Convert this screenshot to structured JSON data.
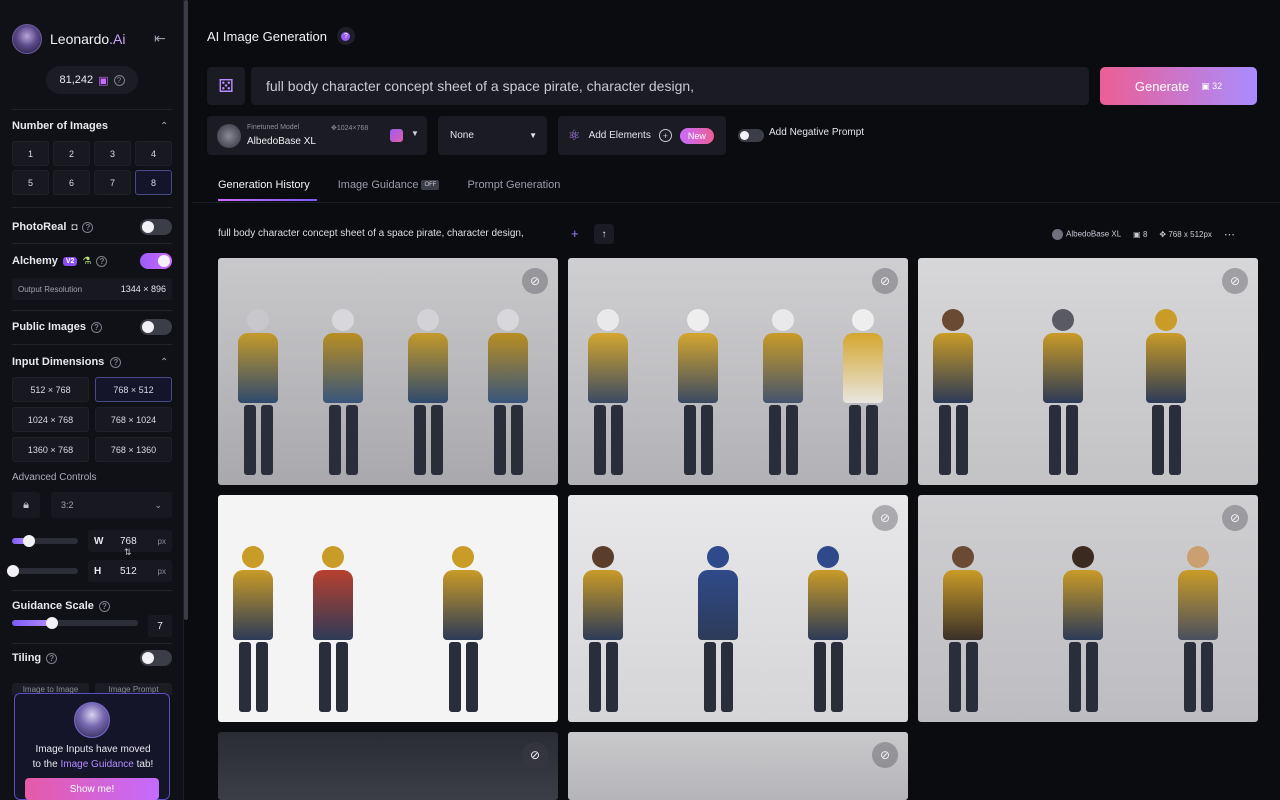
{
  "sidebar": {
    "brand": "Leonardo",
    "brand_ai": ".Ai",
    "credits": "81,242",
    "number_of_images": {
      "title": "Number of Images",
      "options": [
        "1",
        "2",
        "3",
        "4",
        "5",
        "6",
        "7",
        "8"
      ],
      "selected": "8"
    },
    "photoreal": {
      "label": "PhotoReal",
      "on": false
    },
    "alchemy": {
      "label": "Alchemy",
      "badge": "V2",
      "on": true
    },
    "output_resolution": {
      "label": "Output Resolution",
      "value": "1344 × 896"
    },
    "public_images": {
      "label": "Public Images",
      "on": false
    },
    "input_dimensions": {
      "title": "Input Dimensions",
      "options": [
        "512 × 768",
        "768 × 512",
        "1024 × 768",
        "768 × 1024",
        "1360 × 768",
        "768 × 1360"
      ],
      "selected": "768 × 512"
    },
    "advanced_controls": {
      "label": "Advanced Controls",
      "ratio": "3:2"
    },
    "width": {
      "label": "W",
      "value": "768",
      "unit": "px",
      "slider": 0.25
    },
    "height": {
      "label": "H",
      "value": "512",
      "unit": "px",
      "slider": 0.0
    },
    "guidance_scale": {
      "label": "Guidance Scale",
      "value": "7",
      "slider": 0.32
    },
    "tiling": {
      "label": "Tiling",
      "on": false
    },
    "image_tabs": [
      "Image to Image",
      "Image Prompt"
    ],
    "notice": {
      "text_1": "Image Inputs have moved",
      "text_2": "to the",
      "link": "Image Guidance",
      "text_3": "tab!",
      "button": "Show me!"
    }
  },
  "header": {
    "title": "AI Image Generation",
    "prompt": "full body character concept sheet of a space pirate, character design,",
    "generate_label": "Generate",
    "generate_cost": "32"
  },
  "controls": {
    "model_small": "Finetuned Model",
    "model_dims": "1024×768",
    "model_name": "AlbedoBase XL",
    "preset": "None",
    "add_elements": "Add Elements",
    "new_badge": "New",
    "negative_prompt": "Add Negative Prompt"
  },
  "tabs": [
    {
      "label": "Generation History",
      "active": true
    },
    {
      "label": "Image Guidance",
      "badge": "OFF"
    },
    {
      "label": "Prompt Generation"
    }
  ],
  "history": {
    "prompt": "full body character concept sheet of a space pirate, character design,",
    "model": "AlbedoBase XL",
    "count": "8",
    "dims": "768 x 512px"
  },
  "colors": {
    "accent": "#9b5cf6",
    "generate_start": "#ec5e95",
    "generate_end": "#a98cff",
    "bg": "#0b0c10"
  }
}
